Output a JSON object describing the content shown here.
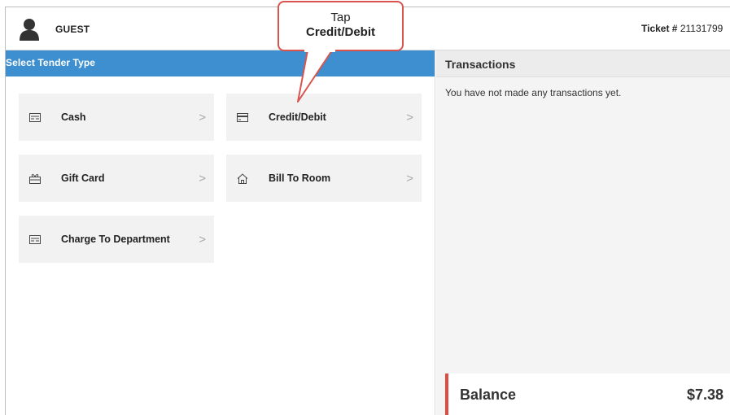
{
  "header": {
    "user_label": "GUEST",
    "ticket_prefix": "Ticket #",
    "ticket_number": "21131799"
  },
  "left_panel": {
    "title": "Select Tender Type",
    "tiles": [
      {
        "label": "Cash",
        "icon": "cash-icon"
      },
      {
        "label": "Credit/Debit",
        "icon": "credit-card-icon"
      },
      {
        "label": "Gift Card",
        "icon": "gift-card-icon"
      },
      {
        "label": "Bill To Room",
        "icon": "home-icon"
      },
      {
        "label": "Charge To Department",
        "icon": "department-card-icon"
      }
    ],
    "chevron_glyph": ">"
  },
  "right_panel": {
    "title": "Transactions",
    "empty_message": "You have not made any transactions yet.",
    "balance_label": "Balance",
    "balance_value": "$7.38",
    "balance_accent": "#e24b3f"
  },
  "callout": {
    "line1": "Tap",
    "line2": "Credit/Debit",
    "border_color": "#d9534f"
  },
  "colors": {
    "header_blue": "#3d8fcf",
    "tile_bg": "#f2f2f2"
  }
}
